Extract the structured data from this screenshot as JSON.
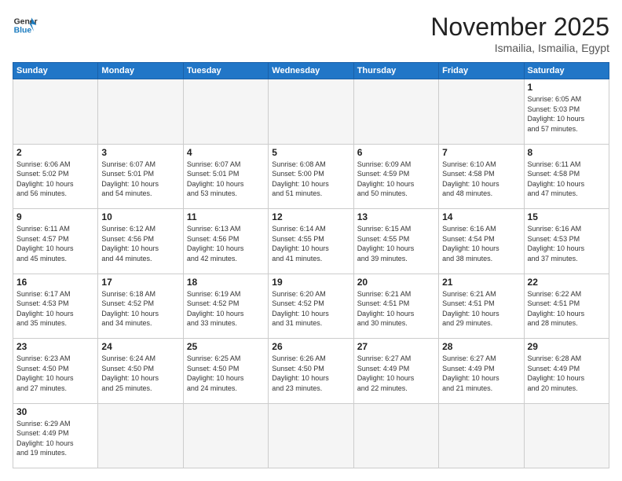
{
  "header": {
    "logo_general": "General",
    "logo_blue": "Blue",
    "month_title": "November 2025",
    "location": "Ismailia, Ismailia, Egypt"
  },
  "weekdays": [
    "Sunday",
    "Monday",
    "Tuesday",
    "Wednesday",
    "Thursday",
    "Friday",
    "Saturday"
  ],
  "days": [
    {
      "num": "",
      "info": ""
    },
    {
      "num": "",
      "info": ""
    },
    {
      "num": "",
      "info": ""
    },
    {
      "num": "",
      "info": ""
    },
    {
      "num": "",
      "info": ""
    },
    {
      "num": "",
      "info": ""
    },
    {
      "num": "1",
      "info": "Sunrise: 6:05 AM\nSunset: 5:03 PM\nDaylight: 10 hours\nand 57 minutes."
    },
    {
      "num": "2",
      "info": "Sunrise: 6:06 AM\nSunset: 5:02 PM\nDaylight: 10 hours\nand 56 minutes."
    },
    {
      "num": "3",
      "info": "Sunrise: 6:07 AM\nSunset: 5:01 PM\nDaylight: 10 hours\nand 54 minutes."
    },
    {
      "num": "4",
      "info": "Sunrise: 6:07 AM\nSunset: 5:01 PM\nDaylight: 10 hours\nand 53 minutes."
    },
    {
      "num": "5",
      "info": "Sunrise: 6:08 AM\nSunset: 5:00 PM\nDaylight: 10 hours\nand 51 minutes."
    },
    {
      "num": "6",
      "info": "Sunrise: 6:09 AM\nSunset: 4:59 PM\nDaylight: 10 hours\nand 50 minutes."
    },
    {
      "num": "7",
      "info": "Sunrise: 6:10 AM\nSunset: 4:58 PM\nDaylight: 10 hours\nand 48 minutes."
    },
    {
      "num": "8",
      "info": "Sunrise: 6:11 AM\nSunset: 4:58 PM\nDaylight: 10 hours\nand 47 minutes."
    },
    {
      "num": "9",
      "info": "Sunrise: 6:11 AM\nSunset: 4:57 PM\nDaylight: 10 hours\nand 45 minutes."
    },
    {
      "num": "10",
      "info": "Sunrise: 6:12 AM\nSunset: 4:56 PM\nDaylight: 10 hours\nand 44 minutes."
    },
    {
      "num": "11",
      "info": "Sunrise: 6:13 AM\nSunset: 4:56 PM\nDaylight: 10 hours\nand 42 minutes."
    },
    {
      "num": "12",
      "info": "Sunrise: 6:14 AM\nSunset: 4:55 PM\nDaylight: 10 hours\nand 41 minutes."
    },
    {
      "num": "13",
      "info": "Sunrise: 6:15 AM\nSunset: 4:55 PM\nDaylight: 10 hours\nand 39 minutes."
    },
    {
      "num": "14",
      "info": "Sunrise: 6:16 AM\nSunset: 4:54 PM\nDaylight: 10 hours\nand 38 minutes."
    },
    {
      "num": "15",
      "info": "Sunrise: 6:16 AM\nSunset: 4:53 PM\nDaylight: 10 hours\nand 37 minutes."
    },
    {
      "num": "16",
      "info": "Sunrise: 6:17 AM\nSunset: 4:53 PM\nDaylight: 10 hours\nand 35 minutes."
    },
    {
      "num": "17",
      "info": "Sunrise: 6:18 AM\nSunset: 4:52 PM\nDaylight: 10 hours\nand 34 minutes."
    },
    {
      "num": "18",
      "info": "Sunrise: 6:19 AM\nSunset: 4:52 PM\nDaylight: 10 hours\nand 33 minutes."
    },
    {
      "num": "19",
      "info": "Sunrise: 6:20 AM\nSunset: 4:52 PM\nDaylight: 10 hours\nand 31 minutes."
    },
    {
      "num": "20",
      "info": "Sunrise: 6:21 AM\nSunset: 4:51 PM\nDaylight: 10 hours\nand 30 minutes."
    },
    {
      "num": "21",
      "info": "Sunrise: 6:21 AM\nSunset: 4:51 PM\nDaylight: 10 hours\nand 29 minutes."
    },
    {
      "num": "22",
      "info": "Sunrise: 6:22 AM\nSunset: 4:51 PM\nDaylight: 10 hours\nand 28 minutes."
    },
    {
      "num": "23",
      "info": "Sunrise: 6:23 AM\nSunset: 4:50 PM\nDaylight: 10 hours\nand 27 minutes."
    },
    {
      "num": "24",
      "info": "Sunrise: 6:24 AM\nSunset: 4:50 PM\nDaylight: 10 hours\nand 25 minutes."
    },
    {
      "num": "25",
      "info": "Sunrise: 6:25 AM\nSunset: 4:50 PM\nDaylight: 10 hours\nand 24 minutes."
    },
    {
      "num": "26",
      "info": "Sunrise: 6:26 AM\nSunset: 4:50 PM\nDaylight: 10 hours\nand 23 minutes."
    },
    {
      "num": "27",
      "info": "Sunrise: 6:27 AM\nSunset: 4:49 PM\nDaylight: 10 hours\nand 22 minutes."
    },
    {
      "num": "28",
      "info": "Sunrise: 6:27 AM\nSunset: 4:49 PM\nDaylight: 10 hours\nand 21 minutes."
    },
    {
      "num": "29",
      "info": "Sunrise: 6:28 AM\nSunset: 4:49 PM\nDaylight: 10 hours\nand 20 minutes."
    },
    {
      "num": "30",
      "info": "Sunrise: 6:29 AM\nSunset: 4:49 PM\nDaylight: 10 hours\nand 19 minutes."
    },
    {
      "num": "",
      "info": ""
    },
    {
      "num": "",
      "info": ""
    },
    {
      "num": "",
      "info": ""
    },
    {
      "num": "",
      "info": ""
    },
    {
      "num": "",
      "info": ""
    },
    {
      "num": "",
      "info": ""
    }
  ]
}
